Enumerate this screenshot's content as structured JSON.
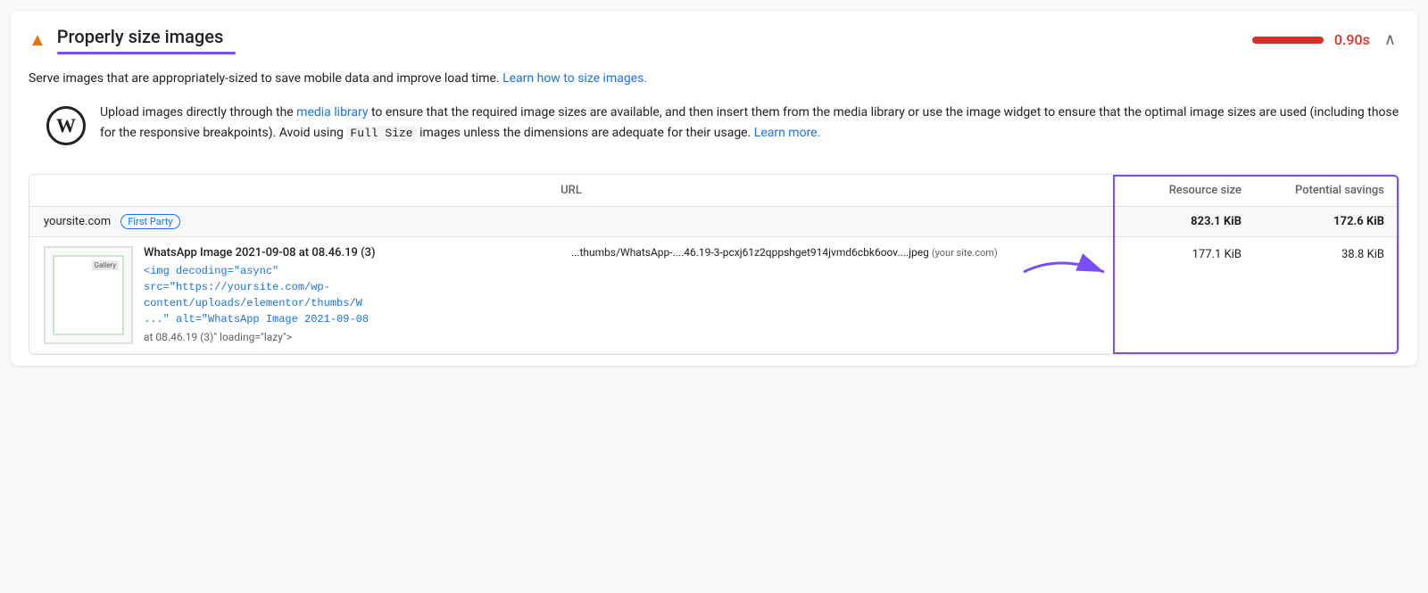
{
  "header": {
    "warning_icon": "▲",
    "title": "Properly size images",
    "score_value": "0.90s",
    "collapse_icon": "∧"
  },
  "description": {
    "main_text": "Serve images that are appropriately-sized to save mobile data and improve load time.",
    "link_text": "Learn how to size images.",
    "link_url": "#"
  },
  "wp_notice": {
    "logo": "W",
    "text_part1": "Upload images directly through the ",
    "media_library_link": "media library",
    "text_part2": " to ensure that the required image sizes are available, and then insert them from the media library or use the image widget to ensure that the optimal image sizes are used (including those for the responsive breakpoints). Avoid using ",
    "code_text": "Full Size",
    "text_part3": " images unless the dimensions are adequate for their usage. ",
    "learn_more_link": "Learn more.",
    "learn_more_url": "#"
  },
  "table": {
    "columns": {
      "url": "URL",
      "resource_size": "Resource size",
      "potential_savings": "Potential savings"
    },
    "group": {
      "name": "yoursite.com",
      "badge": "First Party",
      "resource_size": "823.1 KiB",
      "potential_savings": "172.6 KiB"
    },
    "rows": [
      {
        "title": "WhatsApp Image 2021-09-08 at 08.46.19 (3)",
        "code_line1": "<img decoding=\"async\"",
        "code_line2": "src=\"https://yoursite.com/wp-",
        "code_line3": "content/uploads/elementor/thumbs/W",
        "code_line4": "...\" alt=\"WhatsApp Image 2021-09-08",
        "alt_text": "at 08.46.19 (3)\" loading=\"lazy\">",
        "url": "...thumbs/WhatsApp-....46.19-3-pcxj61z2qppshget914jvmd6cbk6oov....jpeg",
        "url_source": "(your site.com)",
        "resource_size": "177.1 KiB",
        "potential_savings": "38.8 KiB",
        "thumbnail_label": "Gallery"
      }
    ]
  }
}
